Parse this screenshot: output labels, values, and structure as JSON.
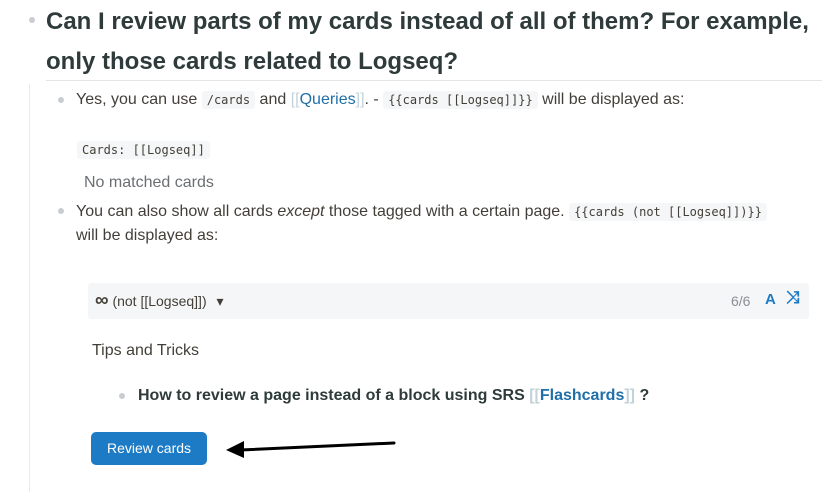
{
  "heading": {
    "line1": "Can I review parts of my cards instead of all of them? For example,",
    "line2": "only those cards related to Logseq?"
  },
  "block1": {
    "prefix": "Yes, you can use",
    "code1": "/cards",
    "and": "and",
    "link_open": "[[",
    "link_text": "Queries",
    "link_close": "]]",
    "dash": ". -",
    "code2": "{{cards [[Logseq]]}}",
    "suffix": "will be displayed as:",
    "cards_code": "Cards: [[Logseq]]",
    "no_match": "No matched cards"
  },
  "block2": {
    "prefix": "You can also show all cards",
    "italic": "except",
    "middle": "those tagged with a certain page.",
    "code": "{{cards (not [[Logseq]])}}",
    "line2": "will be displayed as:"
  },
  "cards_widget": {
    "icon": "∞",
    "query": "(not [[Logseq]])",
    "dropdown_icon": "▾",
    "count": "6/6",
    "font_icon": "A",
    "shuffle_icon": "⤨"
  },
  "tips": {
    "title": "Tips and Tricks",
    "item_prefix": "How to review a page instead of a block using SRS",
    "link_open": "[[",
    "link_text": "Flashcards",
    "link_close": "]]",
    "item_suffix": "?"
  },
  "review_button": {
    "label": "Review cards"
  },
  "colors": {
    "accent": "#1d7bc6",
    "link": "#1f6fa8",
    "bracket": "#c3d3da"
  }
}
